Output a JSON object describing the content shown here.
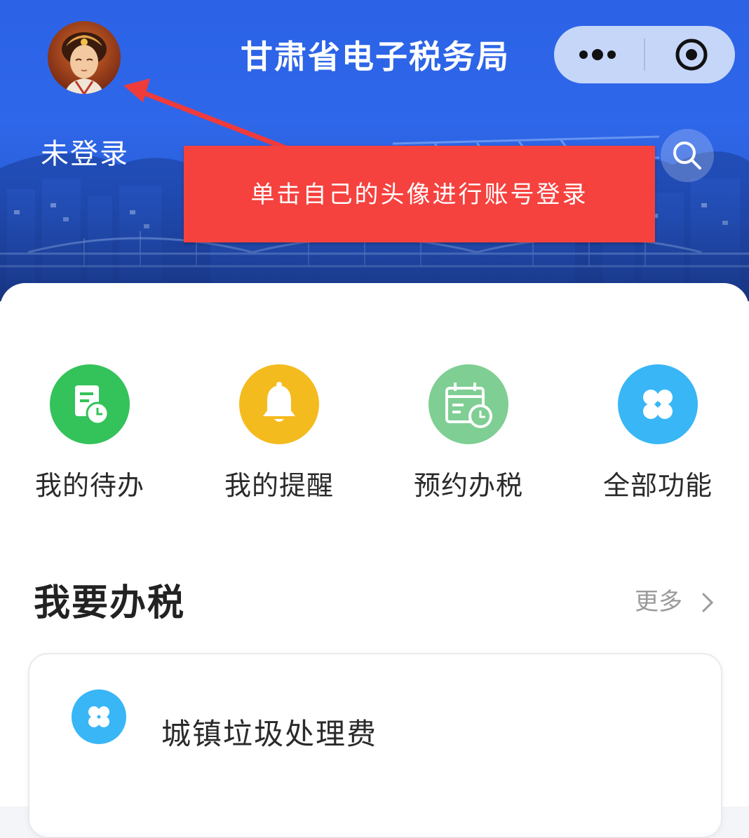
{
  "header": {
    "title": "甘肃省电子税务局",
    "login_status": "未登录",
    "tip": "单击自己的头像进行账号登录"
  },
  "quick_actions": [
    {
      "label": "我的待办",
      "icon": "todo-clock-icon",
      "color": "#34c25a"
    },
    {
      "label": "我的提醒",
      "icon": "bell-icon",
      "color": "#f4bb1e"
    },
    {
      "label": "预约办税",
      "icon": "calendar-clock-icon",
      "color": "#7fce93"
    },
    {
      "label": "全部功能",
      "icon": "grid-four-icon",
      "color": "#38b6f6"
    }
  ],
  "tax_section": {
    "title": "我要办税",
    "more": "更多",
    "items": [
      {
        "label": "城镇垃圾处理费",
        "icon": "grid-four-icon",
        "color": "#38b6f6"
      }
    ]
  },
  "colors": {
    "header_blue": "#2b62e6",
    "tip_red": "#f5423f"
  }
}
